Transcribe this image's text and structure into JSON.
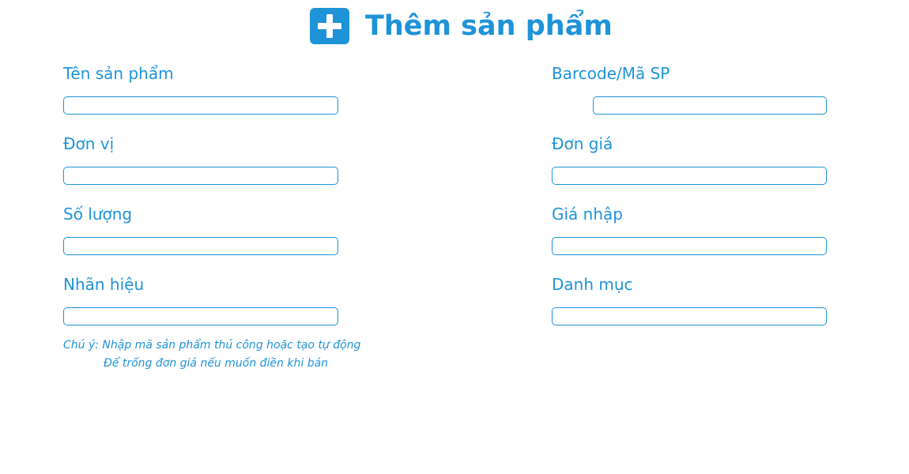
{
  "header": {
    "icon": "plus-icon",
    "title": "Thêm sản phẩm"
  },
  "colors": {
    "accent": "#1e93d8",
    "background": "#ffffff"
  },
  "form": {
    "left_fields": [
      {
        "label": "Tên sản phẩm",
        "value": "",
        "placeholder": ""
      },
      {
        "label": "Đơn vị",
        "value": "",
        "placeholder": ""
      },
      {
        "label": "Số lượng",
        "value": "",
        "placeholder": ""
      },
      {
        "label": "Nhãn hiệu",
        "value": "",
        "placeholder": ""
      }
    ],
    "right_fields": [
      {
        "label": "Barcode/Mã SP",
        "value": "",
        "placeholder": ""
      },
      {
        "label": "Đơn giá",
        "value": "",
        "placeholder": ""
      },
      {
        "label": "Giá nhập",
        "value": "",
        "placeholder": ""
      },
      {
        "label": "Danh mục",
        "value": "",
        "placeholder": ""
      }
    ]
  },
  "notes": {
    "line1": "Chú ý: Nhập mã sản phẩm thủ công hoặc tạo tự động",
    "line2": "Để trống đơn giá nếu muốn điền khi bán"
  }
}
